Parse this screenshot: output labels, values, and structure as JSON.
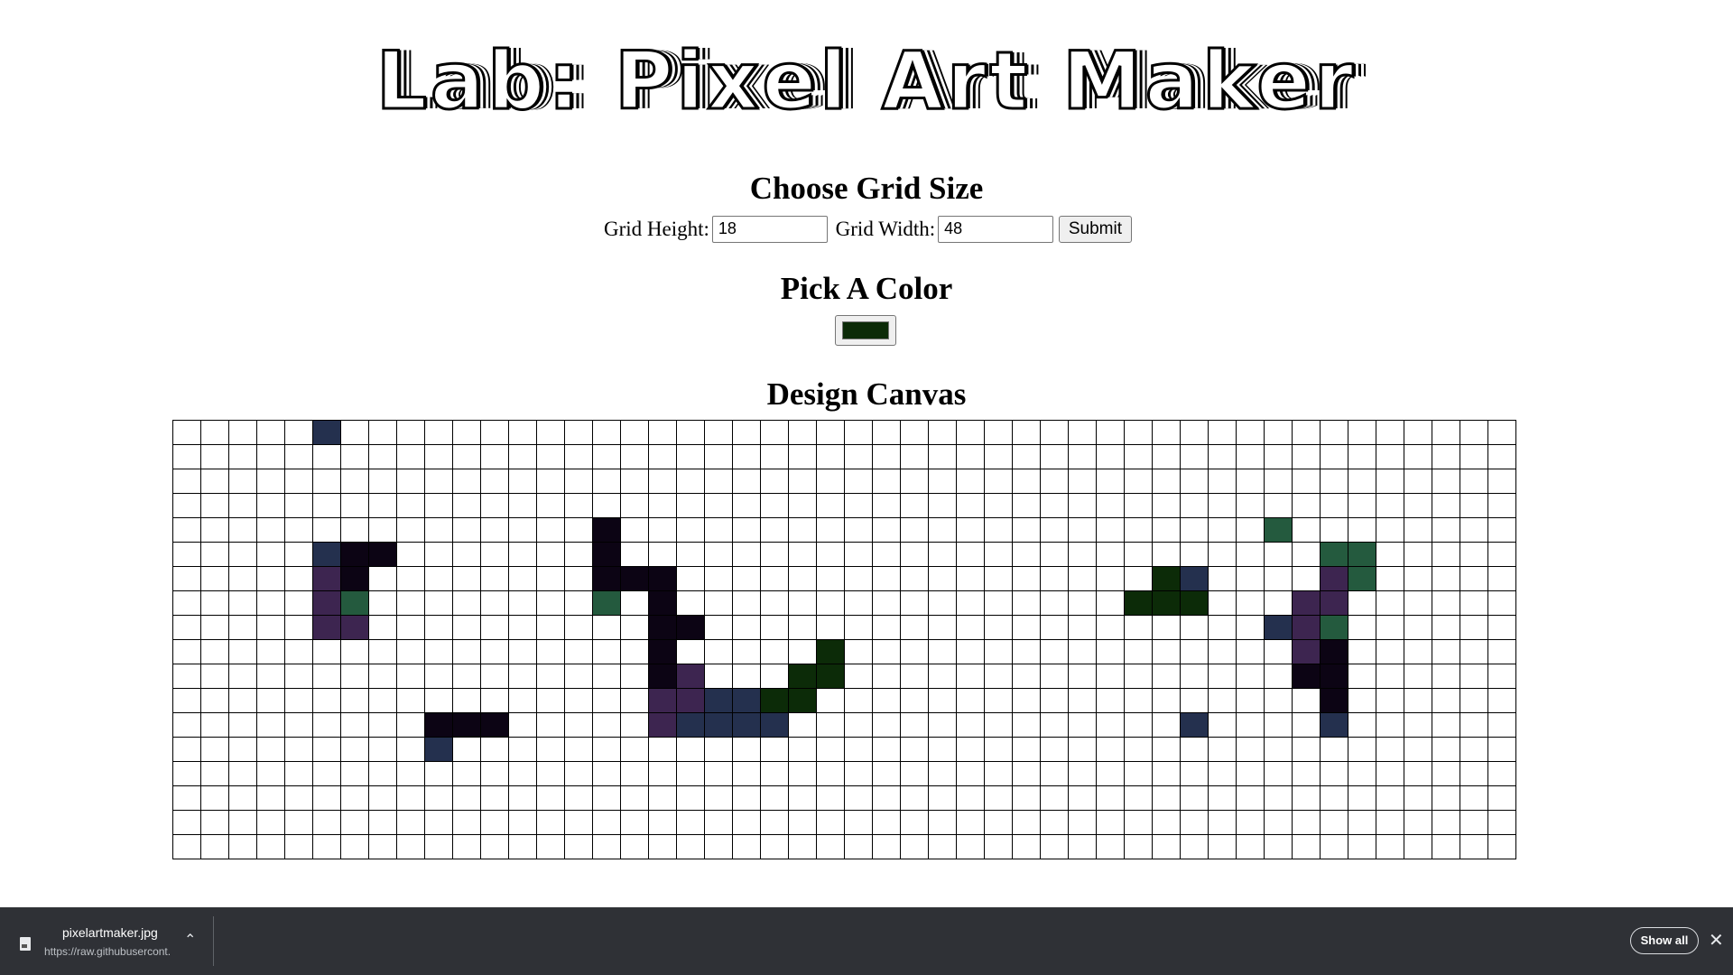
{
  "page": {
    "title": "Lab: Pixel Art Maker"
  },
  "grid_form": {
    "heading": "Choose Grid Size",
    "height_label": "Grid Height:",
    "height_value": "18",
    "width_label": "Grid Width:",
    "width_value": "48",
    "submit_label": "Submit"
  },
  "color_section": {
    "heading": "Pick A Color",
    "selected_color": "#0c2b08"
  },
  "canvas_section": {
    "heading": "Design Canvas"
  },
  "canvas": {
    "rows": 18,
    "cols": 48,
    "palette": {
      "N": "#24304e",
      "K": "#0c0414",
      "P": "#3d2550",
      "T": "#245a3e",
      "G": "#0c2b08"
    },
    "painted": [
      [
        0,
        5,
        "N"
      ],
      [
        4,
        15,
        "K"
      ],
      [
        4,
        39,
        "T"
      ],
      [
        5,
        5,
        "N"
      ],
      [
        5,
        6,
        "K"
      ],
      [
        5,
        7,
        "K"
      ],
      [
        5,
        15,
        "K"
      ],
      [
        5,
        41,
        "T"
      ],
      [
        5,
        42,
        "T"
      ],
      [
        6,
        5,
        "P"
      ],
      [
        6,
        6,
        "K"
      ],
      [
        6,
        15,
        "K"
      ],
      [
        6,
        16,
        "K"
      ],
      [
        6,
        17,
        "K"
      ],
      [
        6,
        35,
        "G"
      ],
      [
        6,
        36,
        "N"
      ],
      [
        6,
        41,
        "P"
      ],
      [
        6,
        42,
        "T"
      ],
      [
        7,
        5,
        "P"
      ],
      [
        7,
        6,
        "T"
      ],
      [
        7,
        15,
        "T"
      ],
      [
        7,
        17,
        "K"
      ],
      [
        7,
        34,
        "G"
      ],
      [
        7,
        35,
        "G"
      ],
      [
        7,
        36,
        "G"
      ],
      [
        7,
        40,
        "P"
      ],
      [
        7,
        41,
        "P"
      ],
      [
        8,
        5,
        "P"
      ],
      [
        8,
        6,
        "P"
      ],
      [
        8,
        17,
        "K"
      ],
      [
        8,
        18,
        "K"
      ],
      [
        8,
        39,
        "N"
      ],
      [
        8,
        40,
        "P"
      ],
      [
        8,
        41,
        "T"
      ],
      [
        9,
        17,
        "K"
      ],
      [
        9,
        23,
        "G"
      ],
      [
        9,
        40,
        "P"
      ],
      [
        9,
        41,
        "K"
      ],
      [
        10,
        17,
        "K"
      ],
      [
        10,
        18,
        "P"
      ],
      [
        10,
        22,
        "G"
      ],
      [
        10,
        23,
        "G"
      ],
      [
        10,
        40,
        "K"
      ],
      [
        10,
        41,
        "K"
      ],
      [
        11,
        17,
        "P"
      ],
      [
        11,
        18,
        "P"
      ],
      [
        11,
        19,
        "N"
      ],
      [
        11,
        20,
        "N"
      ],
      [
        11,
        21,
        "G"
      ],
      [
        11,
        22,
        "G"
      ],
      [
        11,
        41,
        "K"
      ],
      [
        12,
        9,
        "K"
      ],
      [
        12,
        10,
        "K"
      ],
      [
        12,
        11,
        "K"
      ],
      [
        12,
        17,
        "P"
      ],
      [
        12,
        18,
        "N"
      ],
      [
        12,
        19,
        "N"
      ],
      [
        12,
        20,
        "N"
      ],
      [
        12,
        21,
        "N"
      ],
      [
        12,
        36,
        "N"
      ],
      [
        12,
        41,
        "N"
      ],
      [
        13,
        9,
        "N"
      ]
    ]
  },
  "download_bar": {
    "file_name": "pixelartmaker.jpg",
    "file_url": "https://raw.githubusercont...",
    "show_all_label": "Show all"
  }
}
